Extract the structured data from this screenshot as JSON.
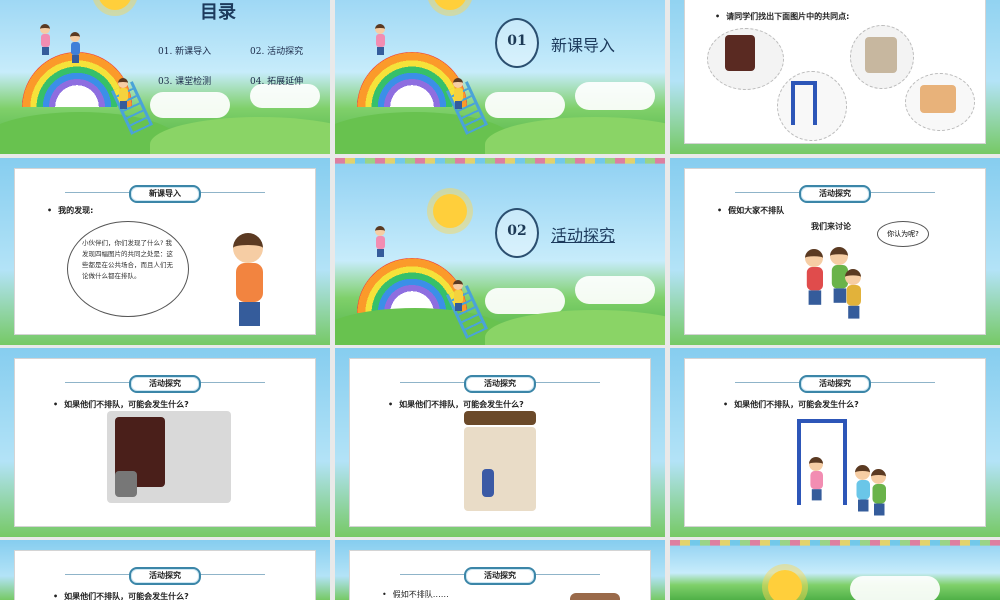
{
  "slides": [
    {
      "id": 1,
      "type": "toc",
      "title": "目录",
      "items": [
        "01. 新课导入",
        "02. 活动探究",
        "03. 课堂检测",
        "04. 拓展延伸"
      ]
    },
    {
      "id": 2,
      "type": "section",
      "number": "01",
      "title": "新课导入"
    },
    {
      "id": 3,
      "type": "content",
      "bullet": "请同学们找出下面图片中的共同点:"
    },
    {
      "id": 4,
      "type": "content",
      "caption": "新课导入",
      "bullet": "我的发现:",
      "speech": "小伙伴们，你们发现了什么?  我发现四幅图片的共同之处是：这些都是在公共场合，而且人们无论做什么都在排队。"
    },
    {
      "id": 5,
      "type": "section",
      "number": "02",
      "title": "活动探究"
    },
    {
      "id": 6,
      "type": "content",
      "caption": "活动探究",
      "bullet": "假如大家不排队",
      "sub": "我们来讨论",
      "speech": "你认为呢?"
    },
    {
      "id": 7,
      "type": "content",
      "caption": "活动探究",
      "bullet": "如果他们不排队，可能会发生什么?"
    },
    {
      "id": 8,
      "type": "content",
      "caption": "活动探究",
      "bullet": "如果他们不排队，可能会发生什么?"
    },
    {
      "id": 9,
      "type": "content",
      "caption": "活动探究",
      "bullet": "如果他们不排队，可能会发生什么?"
    },
    {
      "id": 10,
      "type": "content",
      "caption": "活动探究",
      "bullet": "如果他们不排队，可能会发生什么?"
    },
    {
      "id": 11,
      "type": "content",
      "caption": "活动探究",
      "bullet": "假如不排队……"
    },
    {
      "id": 12,
      "type": "background"
    }
  ]
}
